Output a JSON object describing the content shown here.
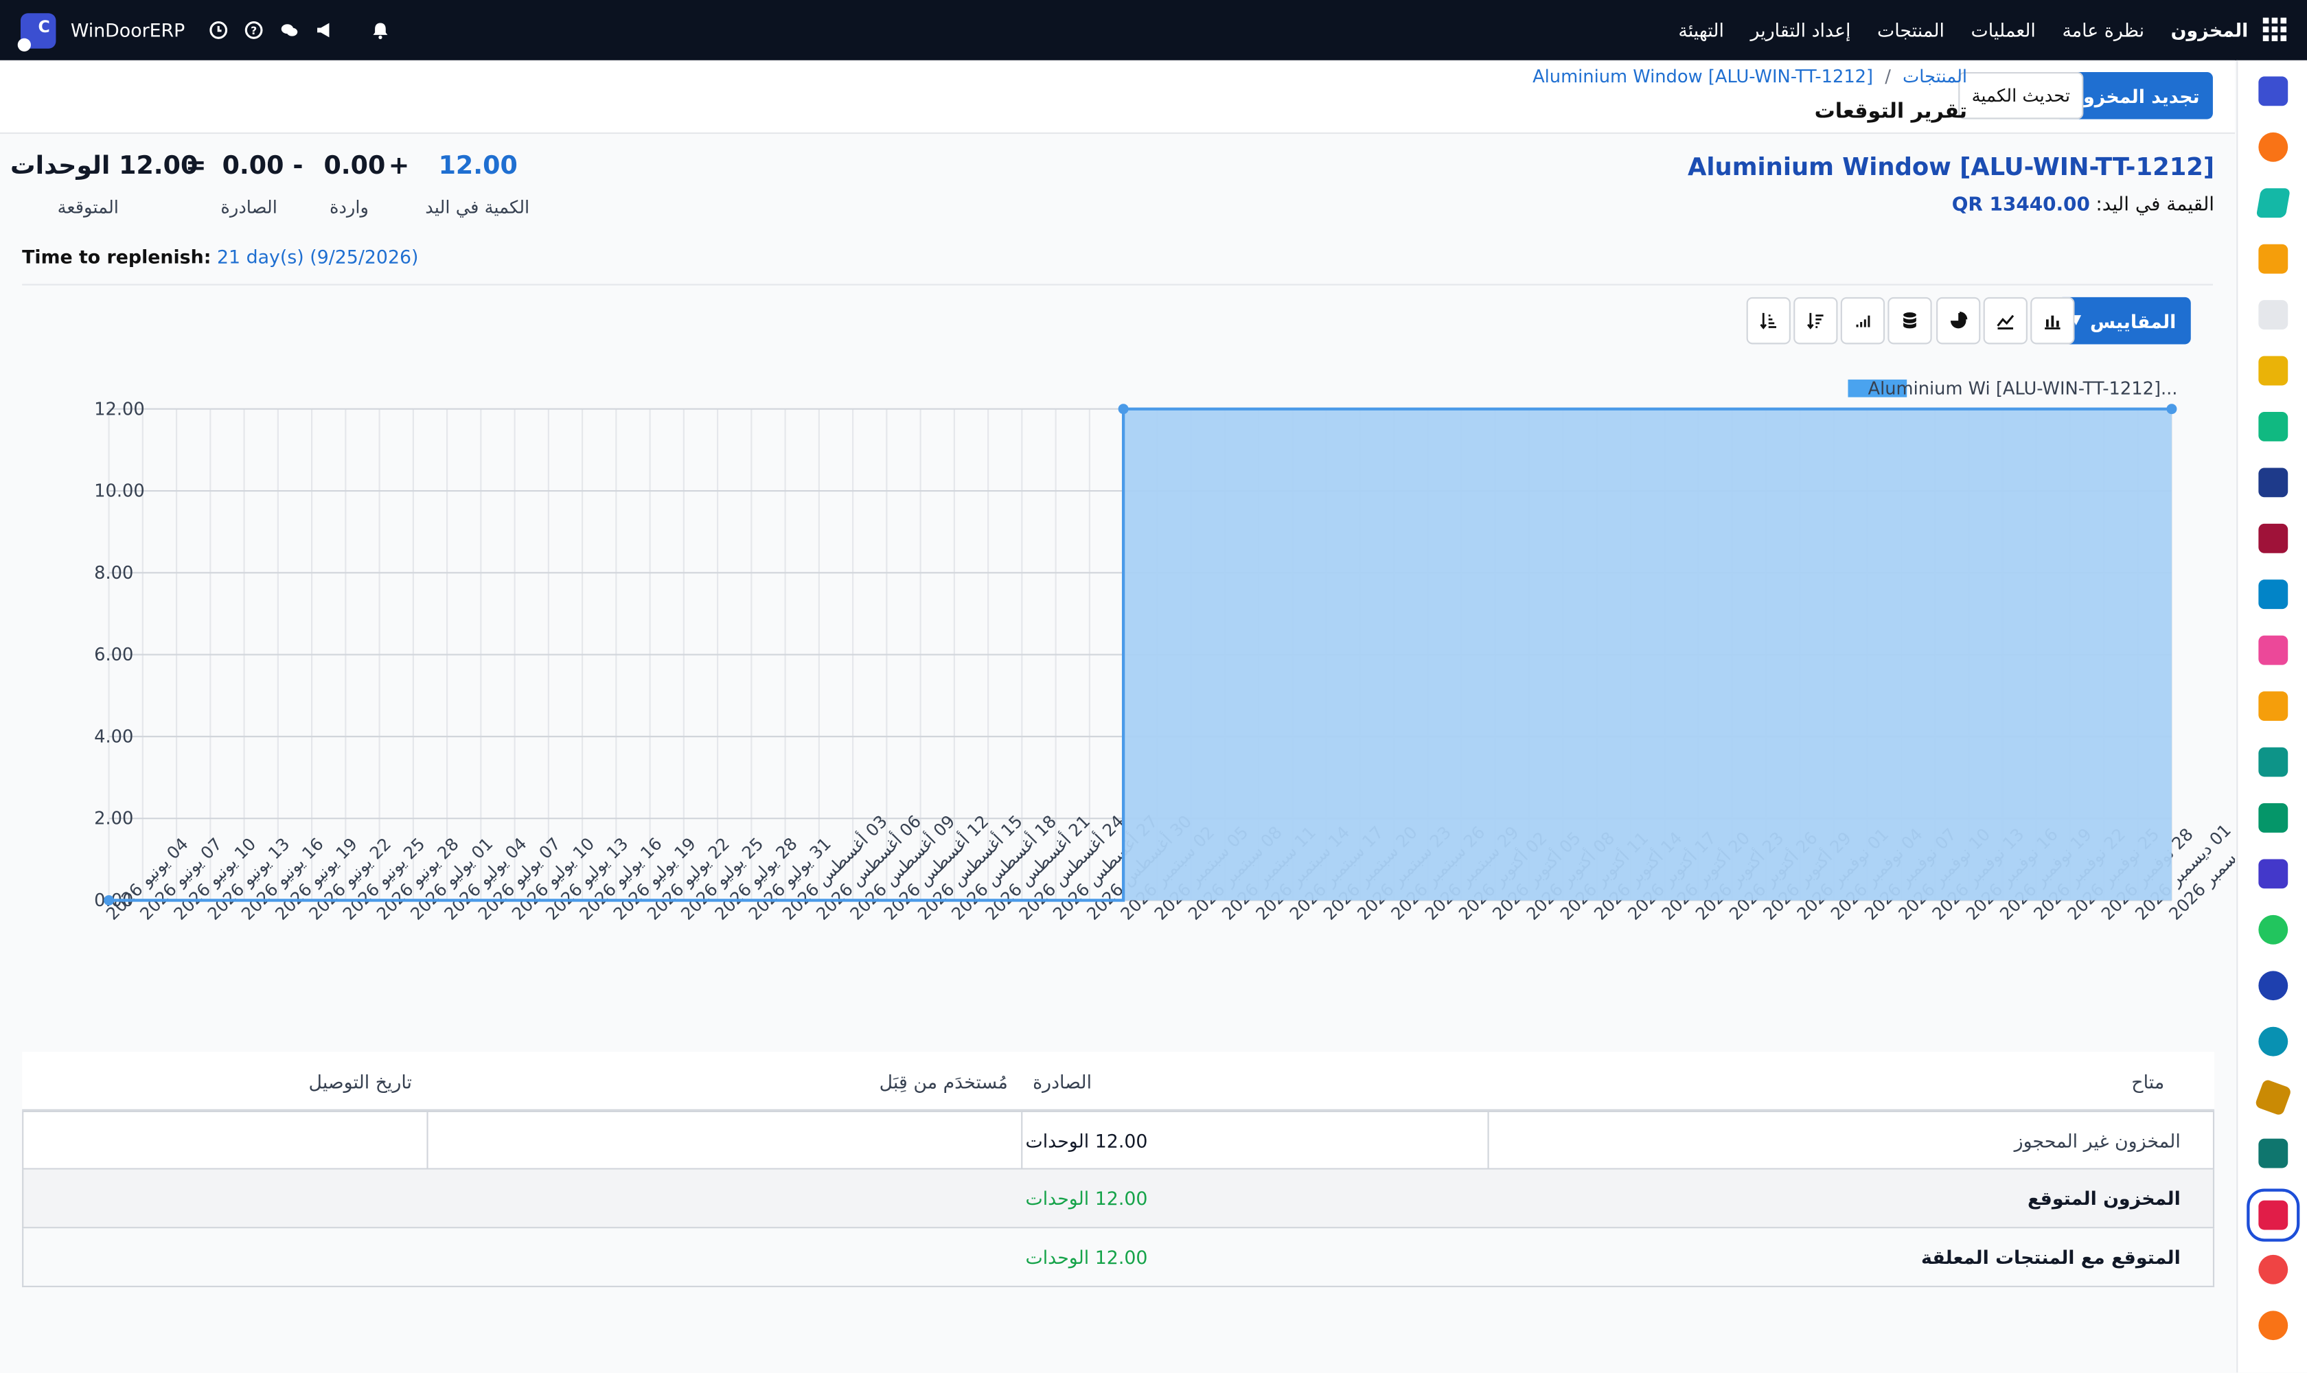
{
  "navbar": {
    "module": "المخزون",
    "menu": [
      "نظرة عامة",
      "العمليات",
      "المنتجات",
      "إعداد التقارير",
      "التهيئة"
    ],
    "company": "WinDoorERP"
  },
  "control_panel": {
    "primary_button": "تجديد المخزون",
    "secondary_button": "تحديث الكمية",
    "breadcrumb_parent": "المنتجات",
    "breadcrumb_current": "Aluminium Window [ALU-WIN-TT-1212]",
    "page_title": "تقرير التوقعات"
  },
  "summary": {
    "product_title": "Aluminium Window [ALU-WIN-TT-1212]",
    "on_hand_value_label": "القيمة في اليد:",
    "on_hand_value": "QR 13440.00",
    "on_hand": "12.00",
    "on_hand_label": "الكمية في اليد",
    "plus": "+",
    "incoming": "0.00",
    "incoming_label": "واردة",
    "minus": "-",
    "outgoing": "0.00",
    "outgoing_label": "الصادرة",
    "equals": "=",
    "forecast": "12.00 الوحدات",
    "forecast_label": "المتوقعة",
    "replenish_label": "Time to replenish:",
    "replenish_value": "21 day(s) (9/25/2026)"
  },
  "toolbar": {
    "measures_label": "المقاييس"
  },
  "chart_data": {
    "type": "area",
    "legend": "Aluminium Wi [ALU-WIN-TT-1212]...",
    "y_ticks": [
      "12.00",
      "10.00",
      "8.00",
      "6.00",
      "4.00",
      "2.00",
      "0.00"
    ],
    "ylim": [
      0,
      12
    ],
    "x": [
      "04 يونيو 2026",
      "07 يونيو 2026",
      "10 يونيو 2026",
      "13 يونيو 2026",
      "16 يونيو 2026",
      "19 يونيو 2026",
      "22 يونيو 2026",
      "25 يونيو 2026",
      "28 يونيو 2026",
      "01 يوليو 2026",
      "04 يوليو 2026",
      "07 يوليو 2026",
      "10 يوليو 2026",
      "13 يوليو 2026",
      "16 يوليو 2026",
      "19 يوليو 2026",
      "22 يوليو 2026",
      "25 يوليو 2026",
      "28 يوليو 2026",
      "31 يوليو 2026",
      "03 أغسطس 2026",
      "06 أغسطس 2026",
      "09 أغسطس 2026",
      "12 أغسطس 2026",
      "15 أغسطس 2026",
      "18 أغسطس 2026",
      "21 أغسطس 2026",
      "24 أغسطس 2026",
      "27 أغسطس 2026",
      "30 أغسطس 2026",
      "02 سبتمبر 2026",
      "05 سبتمبر 2026",
      "08 سبتمبر 2026",
      "11 سبتمبر 2026",
      "14 سبتمبر 2026",
      "17 سبتمبر 2026",
      "20 سبتمبر 2026",
      "23 سبتمبر 2026",
      "26 سبتمبر 2026",
      "29 سبتمبر 2026",
      "02 أكتوبر 2026",
      "05 أكتوبر 2026",
      "08 أكتوبر 2026",
      "11 أكتوبر 2026",
      "14 أكتوبر 2026",
      "17 أكتوبر 2026",
      "20 أكتوبر 2026",
      "23 أكتوبر 2026",
      "26 أكتوبر 2026",
      "29 أكتوبر 2026",
      "01 نوفمبر 2026",
      "04 نوفمبر 2026",
      "07 نوفمبر 2026",
      "10 نوفمبر 2026",
      "13 نوفمبر 2026",
      "16 نوفمبر 2026",
      "19 نوفمبر 2026",
      "22 نوفمبر 2026",
      "25 نوفمبر 2026",
      "28 نوفمبر 2026",
      "01 ديسمبر 2026",
      "04 ديسمبر 2026"
    ],
    "series": [
      {
        "name": "Aluminium Wi [ALU-WIN-TT-1212]...",
        "points": [
          {
            "x": "04 يونيو 2026",
            "y": 0
          },
          {
            "x": "02 سبتمبر 2026",
            "y": 0
          },
          {
            "x": "02 سبتمبر 2026",
            "y": 12
          },
          {
            "x": "04 ديسمبر 2026",
            "y": 12
          }
        ]
      }
    ],
    "grid": true,
    "legend_position": "top-right",
    "colors": {
      "fill": "#a9d1f5",
      "line": "#4a9ae8"
    }
  },
  "table": {
    "headers": [
      "متاح",
      "الصادرة",
      "مُستخدَم من قِبَل",
      "تاريخ التوصيل"
    ],
    "rows": [
      {
        "label": "المخزون غير المحجوز",
        "value": "12.00 الوحدات"
      },
      {
        "label": "المخزون المتوقع",
        "value": "12.00 الوحدات"
      },
      {
        "label": "المتوقع مع المنتجات المعلقة",
        "value": "12.00 الوحدات"
      }
    ]
  },
  "colors": {
    "accent": "#1f6fd1",
    "navbar": "#0b1220",
    "success": "#16a34a"
  }
}
